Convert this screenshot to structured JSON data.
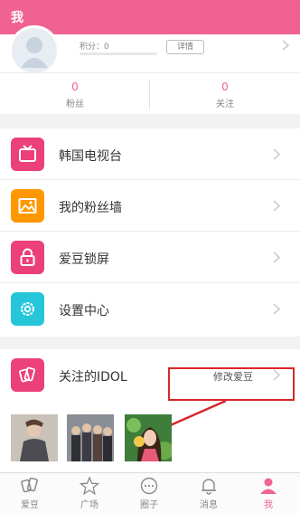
{
  "header": {
    "title": "我"
  },
  "profile": {
    "points_label": "积分：0",
    "detail_label": "详情"
  },
  "stats": [
    {
      "value": "0",
      "label": "粉丝"
    },
    {
      "value": "0",
      "label": "关注"
    }
  ],
  "menu": [
    {
      "label": "韩国电视台",
      "icon": "tv-icon",
      "color": "#ec407a"
    },
    {
      "label": "我的粉丝墙",
      "icon": "image-icon",
      "color": "#ff9800"
    },
    {
      "label": "爱豆锁屏",
      "icon": "lock-icon",
      "color": "#ec407a"
    },
    {
      "label": "设置中心",
      "icon": "gear-icon",
      "color": "#26c6da"
    }
  ],
  "idol": {
    "label": "关注的IDOL",
    "modify_label": "修改爱豆",
    "icon": "cards-icon"
  },
  "tabs": [
    {
      "label": "爱豆",
      "icon": "cards-icon",
      "active": false
    },
    {
      "label": "广场",
      "icon": "star-icon",
      "active": false
    },
    {
      "label": "圈子",
      "icon": "chat-icon",
      "active": false
    },
    {
      "label": "消息",
      "icon": "bell-icon",
      "active": false
    },
    {
      "label": "我",
      "icon": "person-icon",
      "active": true
    }
  ],
  "colors": {
    "accent": "#f06292",
    "annotation": "#d9262c"
  }
}
